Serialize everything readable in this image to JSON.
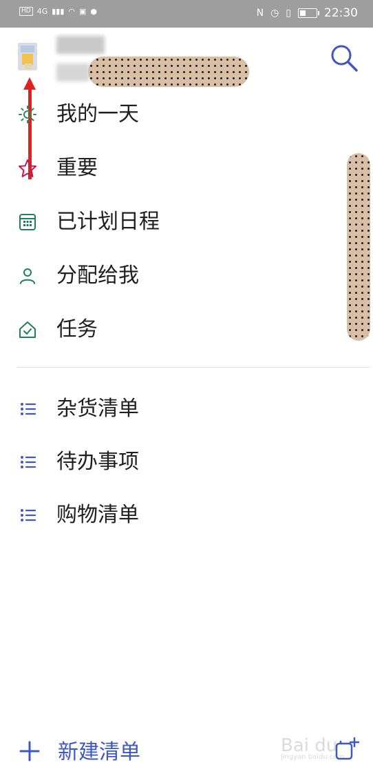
{
  "status_bar": {
    "hd": "HD",
    "network": "4G",
    "time": "22:30"
  },
  "nav": {
    "items": [
      {
        "label": "我的一天",
        "icon": "sun-icon"
      },
      {
        "label": "重要",
        "icon": "star-icon"
      },
      {
        "label": "已计划日程",
        "icon": "calendar-icon"
      },
      {
        "label": "分配给我",
        "icon": "person-icon"
      },
      {
        "label": "任务",
        "icon": "home-check-icon"
      }
    ]
  },
  "lists": {
    "items": [
      {
        "label": "杂货清单",
        "icon": "list-icon"
      },
      {
        "label": "待办事项",
        "icon": "list-icon"
      },
      {
        "label": "购物清单",
        "icon": "list-icon"
      }
    ]
  },
  "footer": {
    "new_list_label": "新建清单"
  },
  "watermark": {
    "text": "Bai du",
    "sub": "jingyan.baidu.com"
  },
  "colors": {
    "accent": "#3d57c6",
    "sun": "#2f8a5b",
    "star": "#c2185b",
    "calendar": "#1e7d5e",
    "person": "#1e7d5e",
    "home": "#1e7d5e",
    "list": "#3d57c6",
    "annotation_arrow": "#e0211c"
  }
}
